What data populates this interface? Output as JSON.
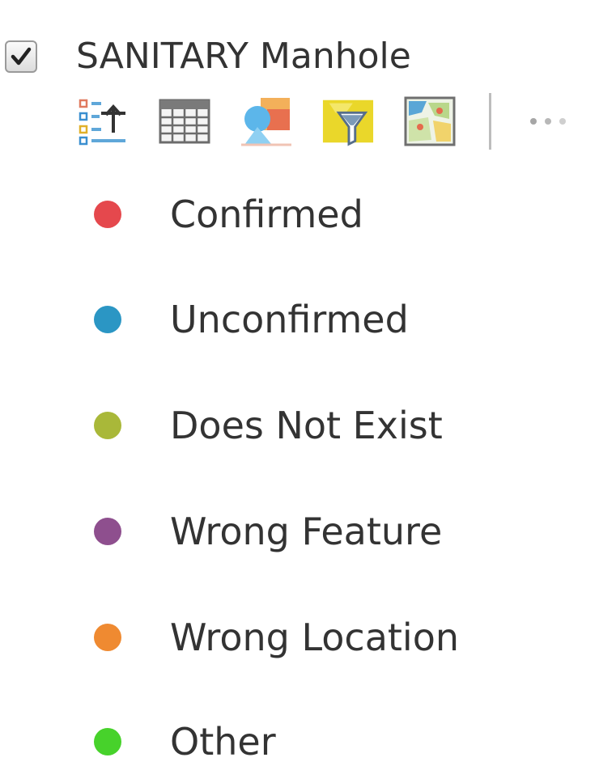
{
  "layer": {
    "checked": true,
    "title": "SANITARY Manhole"
  },
  "toolbar": {
    "icons": [
      "legend-list-icon",
      "attribute-table-icon",
      "change-style-icon",
      "filter-icon",
      "layer-image-icon"
    ],
    "more_icon": "more-options-icon"
  },
  "legend": {
    "items": [
      {
        "label": "Confirmed",
        "color": "#e5484d"
      },
      {
        "label": "Unconfirmed",
        "color": "#2b96c4"
      },
      {
        "label": "Does Not Exist",
        "color": "#a9b839"
      },
      {
        "label": "Wrong Feature",
        "color": "#8e4f8e"
      },
      {
        "label": "Wrong Location",
        "color": "#ef8a31"
      },
      {
        "label": "Other",
        "color": "#47d22b"
      }
    ]
  }
}
